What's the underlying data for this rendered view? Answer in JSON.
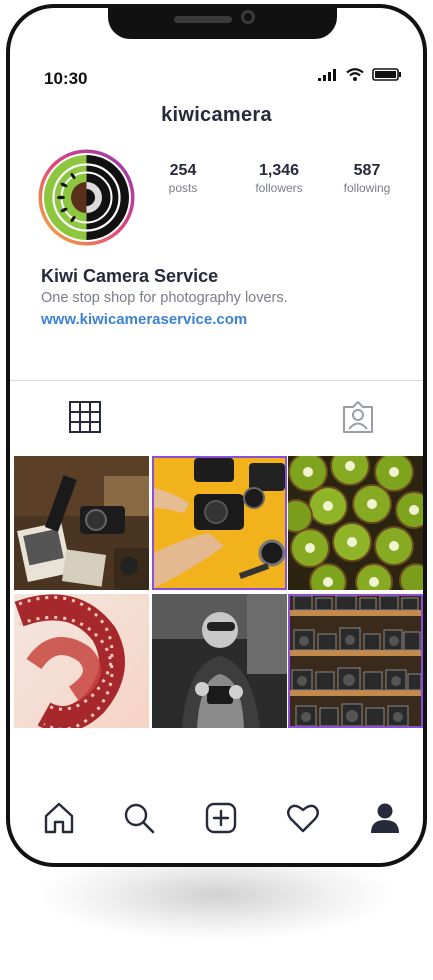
{
  "status_bar": {
    "time": "10:30",
    "icons": [
      "signal-icon",
      "wifi-icon",
      "battery-icon"
    ]
  },
  "profile": {
    "username": "kiwicamera",
    "avatar": "kiwi-camera-logo",
    "stats": [
      {
        "value": "254",
        "label": "posts"
      },
      {
        "value": "1,346",
        "label": "followers"
      },
      {
        "value": "587",
        "label": "following"
      }
    ],
    "bio": {
      "name": "Kiwi Camera Service",
      "text": "One stop shop for photography lovers.",
      "link": "www.kiwicameraservice.com"
    }
  },
  "tabs": [
    {
      "icon": "grid-icon",
      "active": true
    },
    {
      "icon": "tagged-person-icon",
      "active": false
    }
  ],
  "posts": [
    {
      "subject": "vintage cameras and photos on table"
    },
    {
      "subject": "hands repairing camera on yellow table"
    },
    {
      "subject": "kiwi fruit halves"
    },
    {
      "subject": "film strip close-up"
    },
    {
      "subject": "technician repairing camera"
    },
    {
      "subject": "shelves of vintage cameras"
    }
  ],
  "bottom_nav": [
    "home-icon",
    "search-icon",
    "add-post-icon",
    "heart-icon",
    "profile-icon"
  ],
  "colors": {
    "accent_link": "#3b82d6",
    "highlight_border": "#8a4fd8",
    "kiwi_green": "#8dc63f"
  }
}
